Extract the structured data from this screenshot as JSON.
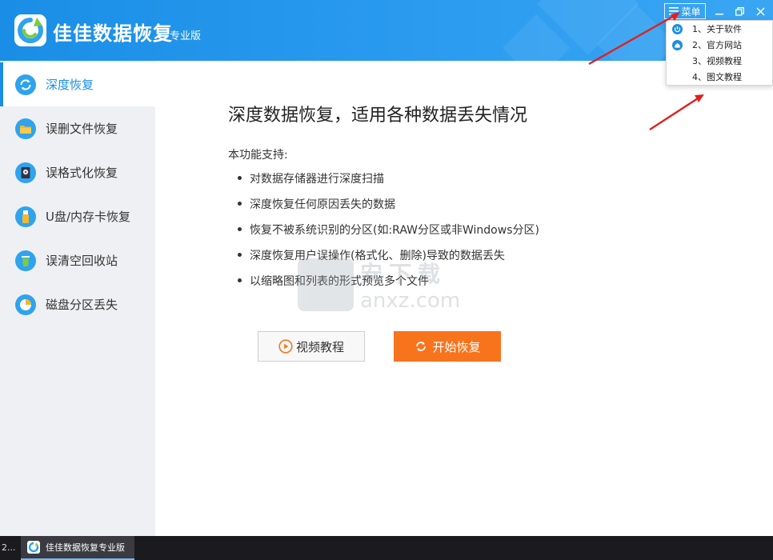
{
  "titlebar": {
    "app_name": "佳佳数据恢复",
    "edition": "专业版",
    "menu_label": "菜单"
  },
  "menu": {
    "items": [
      {
        "label": "1、关于软件",
        "icon": "power-icon"
      },
      {
        "label": "2、官方网站",
        "icon": "home-icon"
      },
      {
        "label": "3、视频教程",
        "icon": ""
      },
      {
        "label": "4、图文教程",
        "icon": ""
      }
    ]
  },
  "sidebar": {
    "items": [
      {
        "label": "深度恢复",
        "icon": "refresh-circle-icon",
        "active": true
      },
      {
        "label": "误删文件恢复",
        "icon": "folder-icon"
      },
      {
        "label": "误格式化恢复",
        "icon": "hard-disk-icon"
      },
      {
        "label": "U盘/内存卡恢复",
        "icon": "usb-drive-icon"
      },
      {
        "label": "误清空回收站",
        "icon": "recycle-bin-icon"
      },
      {
        "label": "磁盘分区丢失",
        "icon": "pie-chart-icon"
      }
    ]
  },
  "main": {
    "heading": "深度数据恢复，适用各种数据丢失情况",
    "support_label": "本功能支持:",
    "features": [
      "对数据存储器进行深度扫描",
      "深度恢复任何原因丢失的数据",
      "恢复不被系统识别的分区(如:RAW分区或非Windows分区)",
      "深度恢复用户误操作(格式化、删除)导致的数据丢失",
      "以缩略图和列表的形式预览多个文件"
    ],
    "video_button": "视频教程",
    "start_button": "开始恢复"
  },
  "watermark": {
    "cn": "安下载",
    "en": "anxz.com"
  },
  "taskbar": {
    "left_text": "2...",
    "app_label": "佳佳数据恢复专业版"
  },
  "colors": {
    "titlebar_blue": "#1a8ee6",
    "accent_orange": "#f7741d",
    "sidebar_bg": "#eef0f3",
    "arrow_red": "#e02020"
  }
}
